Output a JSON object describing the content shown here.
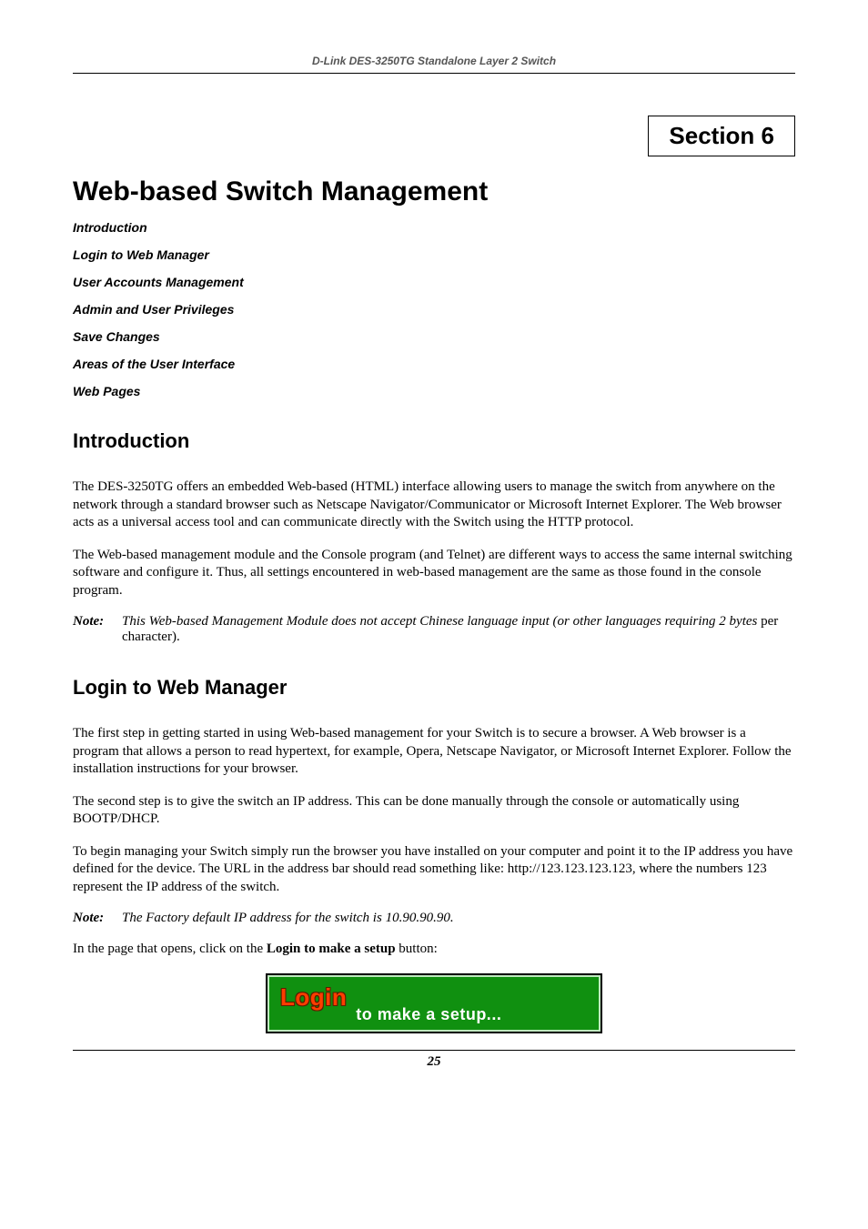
{
  "header": {
    "running": "D-Link DES-3250TG Standalone Layer 2 Switch"
  },
  "section_box": "Section 6",
  "chapter_title": "Web-based Switch Management",
  "toc": [
    "Introduction",
    "Login to Web Manager",
    "User Accounts Management",
    "Admin and User Privileges",
    "Save Changes",
    "Areas of the User Interface",
    "Web Pages"
  ],
  "intro": {
    "heading": "Introduction",
    "p1": "The DES-3250TG offers an embedded Web-based (HTML) interface allowing users to manage the switch from anywhere on the network through a standard browser such as Netscape Navigator/Communicator or Microsoft Internet Explorer. The Web browser acts as a universal access tool and can communicate directly with the Switch using the HTTP protocol.",
    "p2": "The Web-based management module and the Console program (and Telnet) are different ways to access the same internal switching software and configure it. Thus, all settings encountered in web-based management are the same as those found in the console program.",
    "note_label": "Note:",
    "note_ital": "This Web-based Management Module does not accept Chinese language input (or other languages requiring 2 bytes ",
    "note_tail": "per character)."
  },
  "login": {
    "heading": "Login to Web Manager",
    "p1": "The first step in getting started in using Web-based management for your Switch is to secure a browser. A Web browser is a program that allows a person to read hypertext, for example, Opera, Netscape Navigator, or Microsoft Internet Explorer. Follow the installation instructions for your browser.",
    "p2": "The second step is to give the switch an IP address. This can be done manually through the console or automatically using BOOTP/DHCP.",
    "p3": "To begin managing your Switch simply run the browser you have installed on your computer and point it to the IP address you have defined for the device. The URL in the address bar should read something like: http://123.123.123.123, where the numbers 123 represent the IP address of the switch.",
    "note_label": "Note:",
    "note_ital": "The Factory default IP address for the switch is 10.90.90.90.",
    "p4_pre": "In the page that opens, click on the ",
    "p4_bold": "Login to make a setup",
    "p4_post": " button:",
    "fig_login": "Login",
    "fig_rest": "to make a setup..."
  },
  "footer": {
    "page_number": "25"
  }
}
